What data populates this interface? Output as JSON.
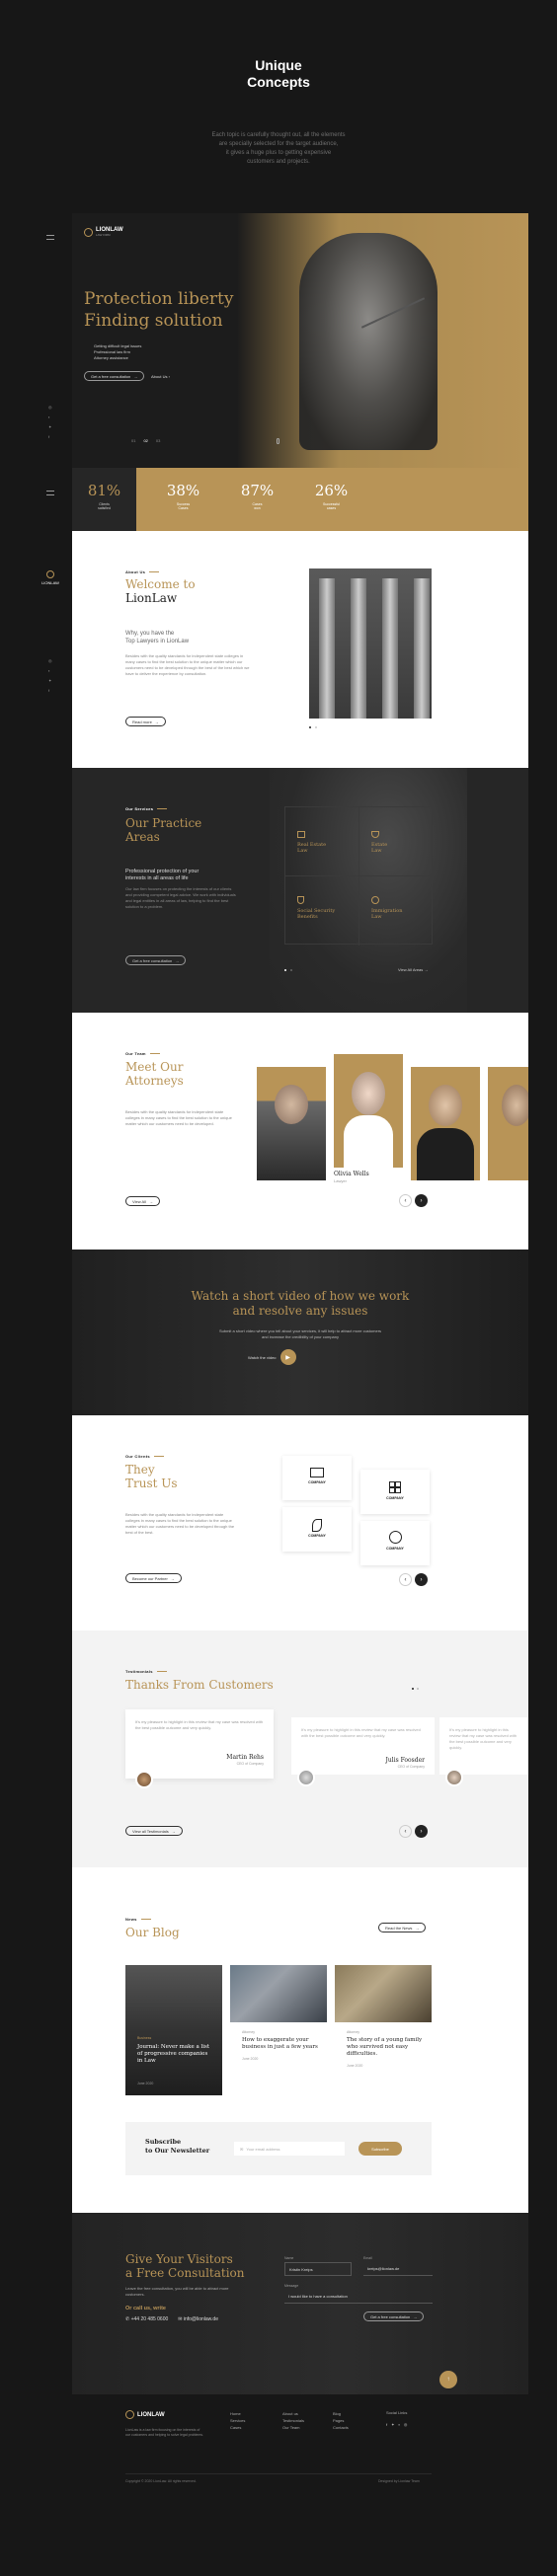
{
  "intro": {
    "title_line1": "Unique",
    "title_line2": "Concepts",
    "desc_line1": "Each topic is carefully thought out, all the elements",
    "desc_line2": "are specially selected for the target audience,",
    "desc_line3": "it gives a huge plus to getting expensive",
    "desc_line4": "customers and projects."
  },
  "hero": {
    "logo": "LIONLAW",
    "logo_sub": "LAW FIRM",
    "title_line1": "Protection liberty",
    "title_line2": "Finding solution",
    "bullets": [
      "Getting difficult legal issues",
      "Professional law firm",
      "Attorney assistance"
    ],
    "cta_primary": "Get a free consultation",
    "cta_secondary": "About Us",
    "slider": [
      "01",
      "02",
      "03"
    ],
    "stats": [
      {
        "value": "81%",
        "label_line1": "Clients",
        "label_line2": "satisfied"
      },
      {
        "value": "38%",
        "label_line1": "Success",
        "label_line2": "Cases"
      },
      {
        "value": "87%",
        "label_line1": "Cases",
        "label_line2": "won"
      },
      {
        "value": "26%",
        "label_line1": "Successful",
        "label_line2": "cases"
      }
    ]
  },
  "side": {
    "logo": "LIONLAW"
  },
  "about": {
    "eyebrow": "About Us",
    "title_line1": "Welcome to",
    "title_line2": "LionLaw",
    "sub_line1": "Why, you have the",
    "sub_line2": "Top Lawyers in LionLaw",
    "body": "Besides with the quality standards for independent state colleges in many cases to find the best solution to the unique matter which our customers need to be developed through the best of the best which we have to deliver the experience by consultation.",
    "button": "Read more"
  },
  "practice": {
    "eyebrow": "Our Services",
    "title_line1": "Our Practice",
    "title_line2": "Areas",
    "lead_line1": "Professional protection of your",
    "lead_line2": "interests in all areas of life",
    "body": "Our law firm focuses on protecting the interests of our clients and providing competent legal advice. We work with individuals and legal entities in all areas of law, helping to find the best solution to a problem.",
    "button": "Get a free consultation",
    "areas": [
      {
        "l1": "Real Estate",
        "l2": "Law"
      },
      {
        "l1": "Estate",
        "l2": "Law"
      },
      {
        "l1": "Social Security",
        "l2": "Benefits"
      },
      {
        "l1": "Immigration",
        "l2": "Law"
      }
    ],
    "view_all": "View All Areas"
  },
  "team": {
    "eyebrow": "Our Team",
    "title_line1": "Meet Our",
    "title_line2": "Attorneys",
    "body": "Besides with the quality standards for independent state colleges in many cases to find the best solution to the unique matter which our customers need to be developed.",
    "button": "View All",
    "featured_name": "Olivia Wells",
    "featured_role": "Lawyer"
  },
  "video": {
    "title_line1": "Watch a short video of how we work",
    "title_line2": "and resolve any issues",
    "sub_line1": "Submit a short video where you tell about your services, it will help to attract more customers",
    "sub_line2": "and increase the credibility of your company",
    "play": "Watch the video"
  },
  "clients": {
    "eyebrow": "Our Clients",
    "title_line1": "They",
    "title_line2": "Trust Us",
    "body": "Besides with the quality standards for independent state colleges in many cases to find the best solution to the unique matter which our customers need to be developed through the best of the best.",
    "button": "Become our Partner",
    "logos": [
      "COMPANY",
      "COMPANY",
      "COMPANY",
      "COMPANY"
    ]
  },
  "testimonials": {
    "eyebrow": "Testimonials",
    "title": "Thanks From Customers",
    "quote": "It's my pleasure to highlight in this review that my case was resolved with the best possible outcome and very quickly.",
    "names": [
      "Martin Rehs",
      "Julis Foosder"
    ],
    "role": "CEO of Company",
    "button": "View all Testimonials"
  },
  "blog": {
    "eyebrow": "News",
    "title": "Our Blog",
    "button": "Read the News",
    "posts": [
      {
        "tag": "Business",
        "title": "Journal: Never make a list of progressive companies in Law",
        "date": "June 2020"
      },
      {
        "tag": "Attorney",
        "title": "How to exaggerate your business in just a few years",
        "date": "June 2020"
      },
      {
        "tag": "Attorney",
        "title": "The story of a young family who survived not easy difficulties.",
        "date": "June 2020"
      }
    ],
    "subscribe_line1": "Subscribe",
    "subscribe_line2": "to Our Newsletter",
    "email_placeholder": "Your email address",
    "subscribe_button": "Subscribe"
  },
  "consult": {
    "title_line1": "Give Your Visitors",
    "title_line2": "a Free Consultation",
    "body": "Leave the free consultation, you will be able to attract more customers.",
    "call": "Or call us, write",
    "phone": "+44 20 485 0600",
    "email": "info@lionlaw.de",
    "field_name": "Name",
    "field_name_value": "Kristin Kreips",
    "field_email": "Email",
    "field_email_value": "kreips@lionlaw.de",
    "field_message": "Message",
    "field_message_value": "I would like to have a consultation",
    "submit": "Get a free consultation"
  },
  "footer": {
    "logo": "LIONLAW",
    "body": "LionLaw is a law firm focusing on the interests of our customers and helping to solve legal problems.",
    "col1": [
      "Home",
      "Services",
      "Cases"
    ],
    "col2": [
      "About us",
      "Testimonials",
      "Our Team"
    ],
    "col3": [
      "Blog",
      "Pages",
      "Contacts"
    ],
    "social_title": "Social Links",
    "copyright": "Copyright © 2020 LionLaw. All rights reserved.",
    "credit": "Designed by Lionlaw Team"
  },
  "colors": {
    "gold": "#b89457",
    "dark": "#171717",
    "panel": "#262626"
  }
}
